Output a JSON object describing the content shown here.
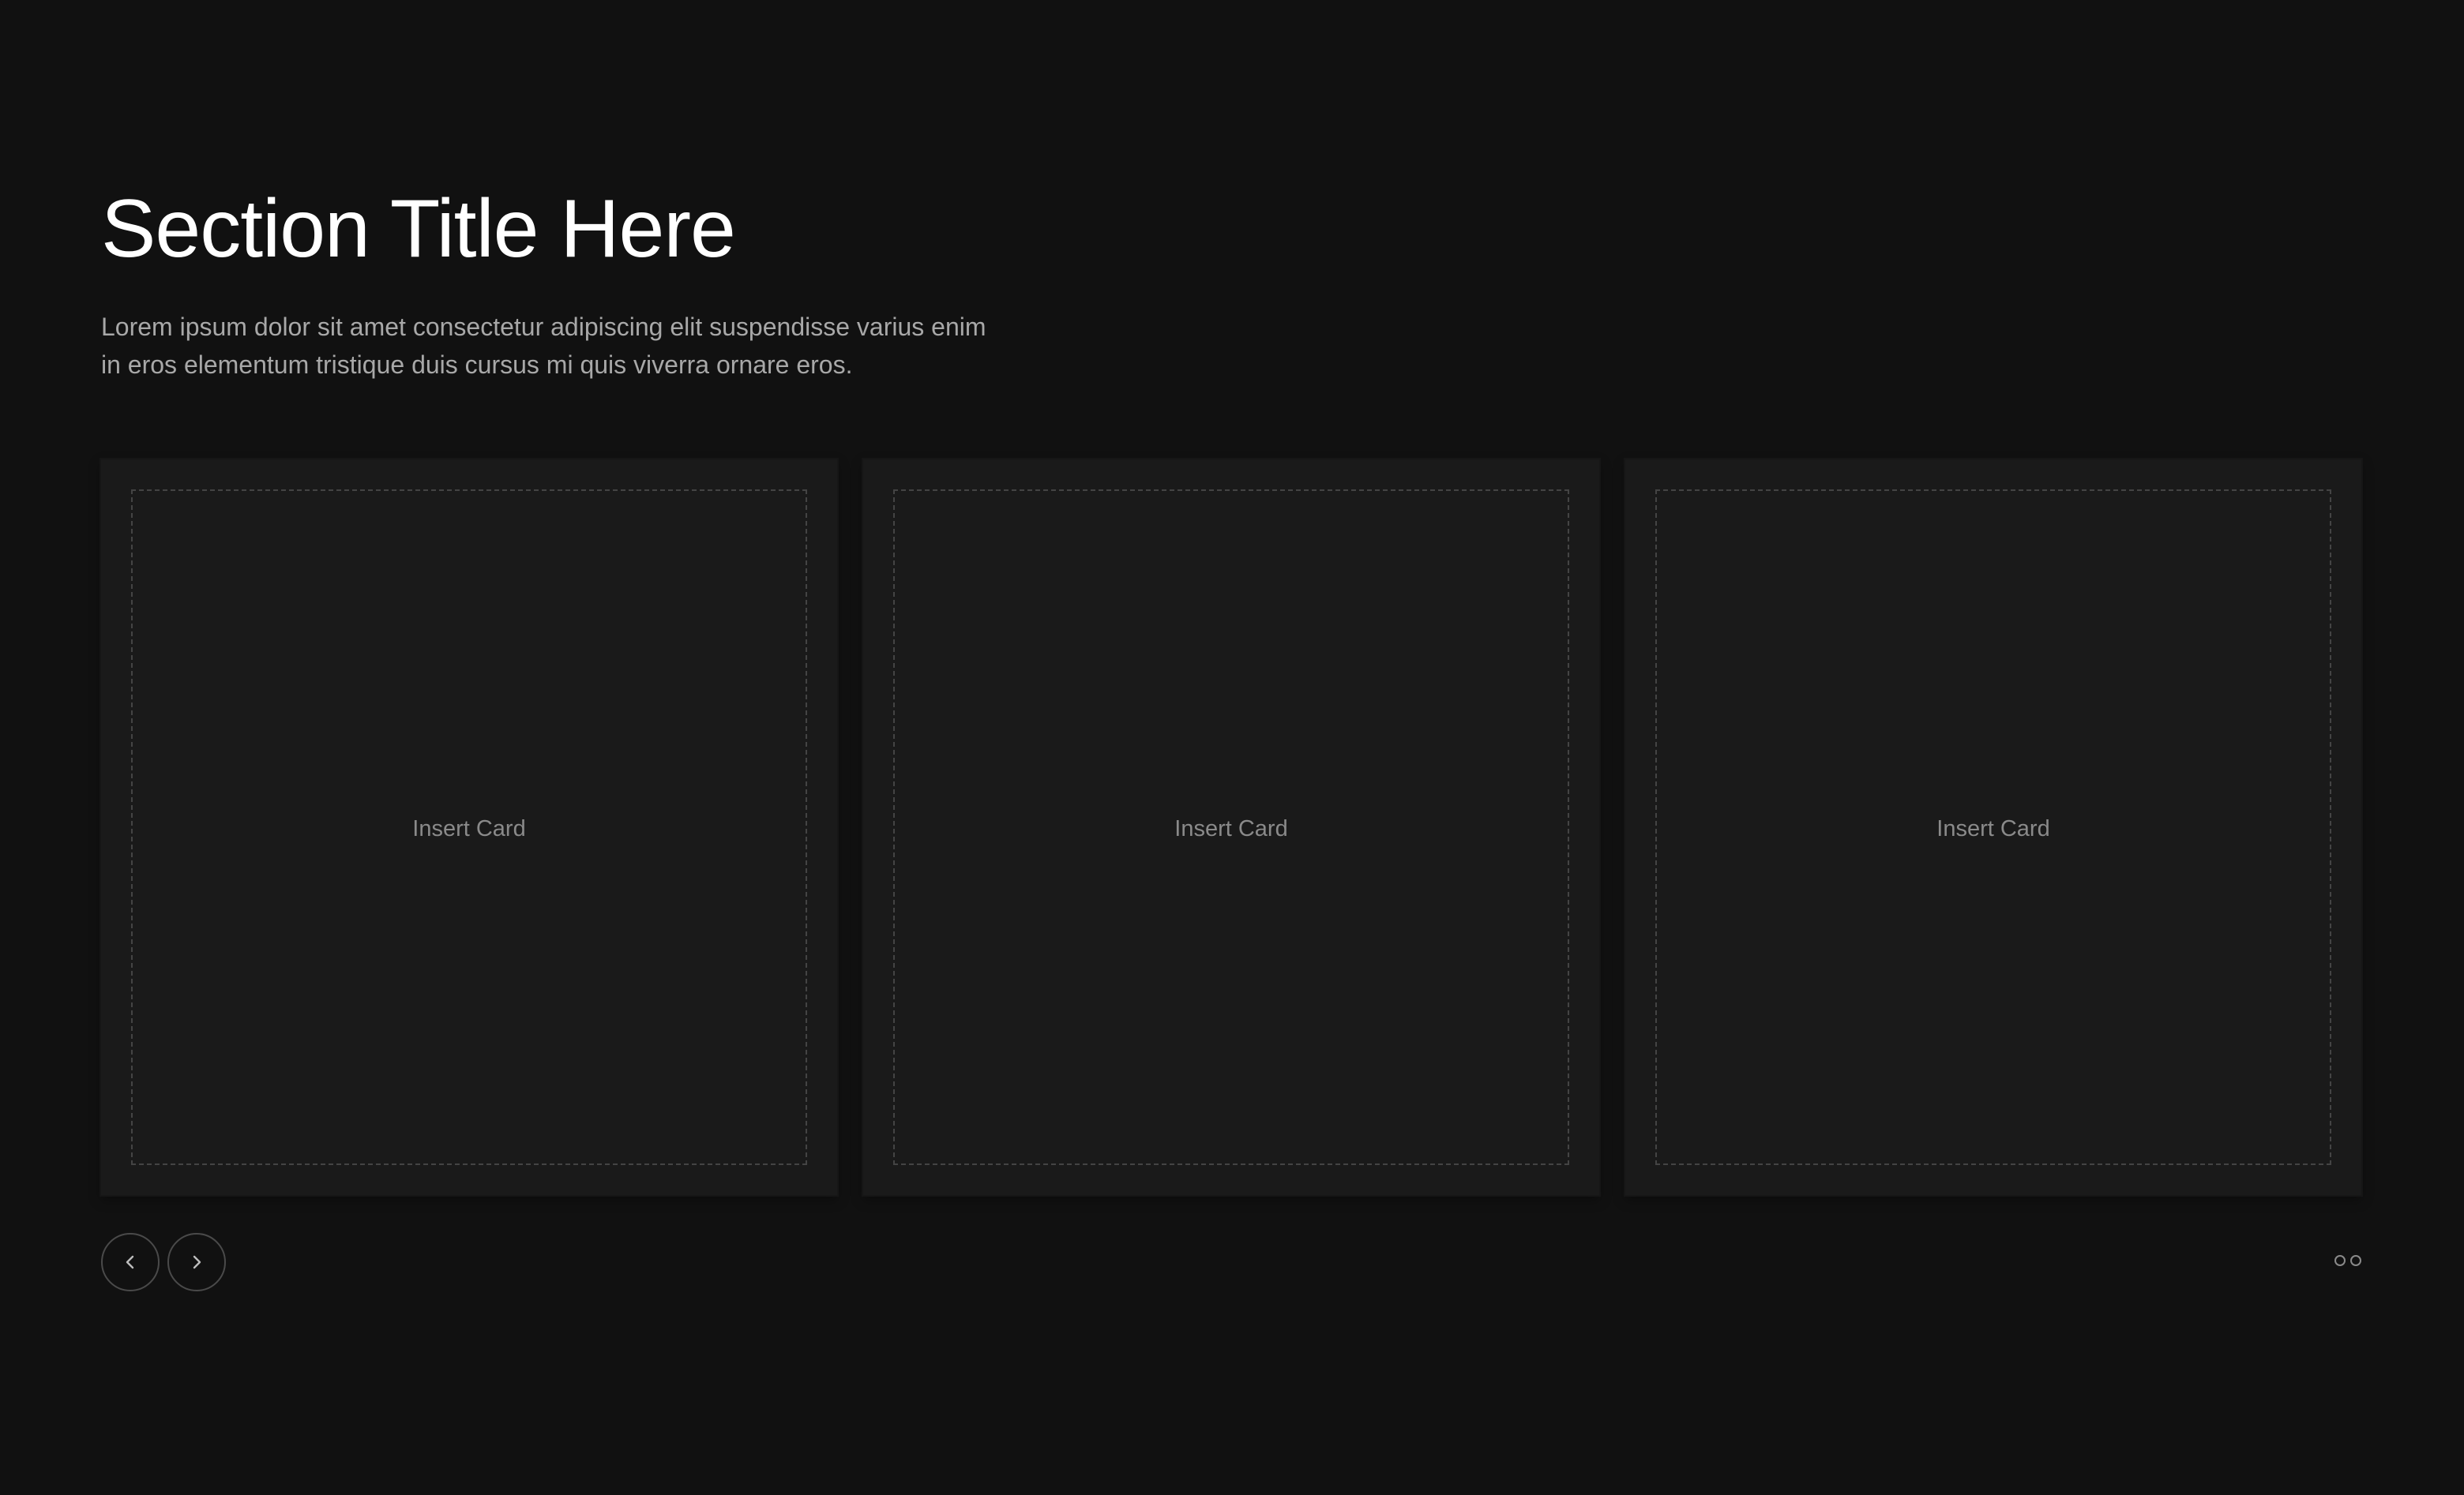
{
  "section": {
    "title": "Section Title Here",
    "description": "Lorem ipsum dolor sit amet consectetur adipiscing elit suspendisse varius enim in eros elementum tristique duis cursus mi quis viverra ornare eros."
  },
  "cards": [
    {
      "label": "Insert Card"
    },
    {
      "label": "Insert Card"
    },
    {
      "label": "Insert Card"
    }
  ],
  "navigation": {
    "prev_icon": "chevron-left-icon",
    "next_icon": "chevron-right-icon"
  },
  "pagination": {
    "dot_count": 2
  },
  "colors": {
    "background": "#111111",
    "card_background": "#1a1a1a",
    "title": "#ffffff",
    "body_text": "#a8a8a8",
    "muted": "#8a8a8a"
  }
}
